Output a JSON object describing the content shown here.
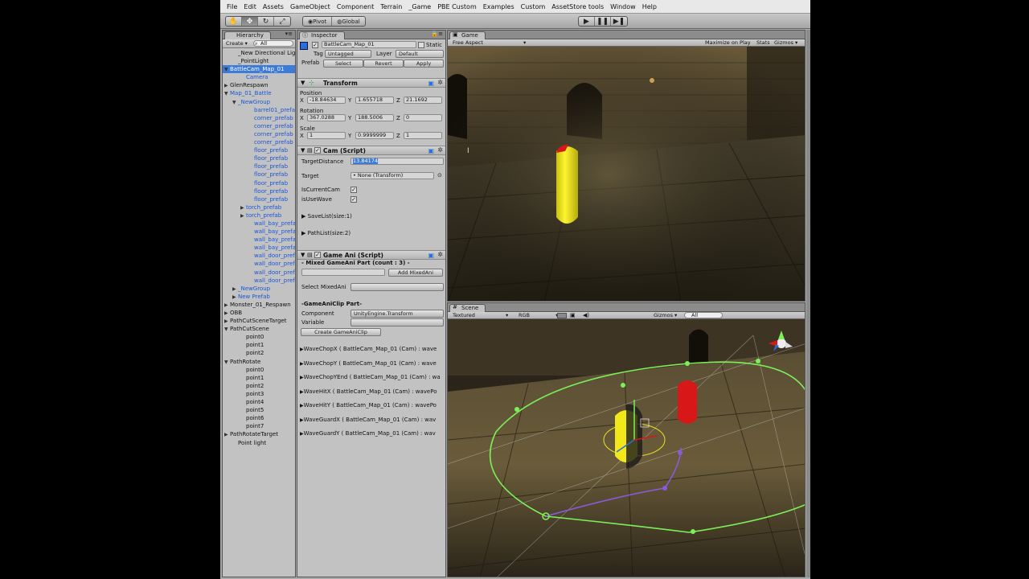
{
  "menu": [
    "File",
    "Edit",
    "Assets",
    "GameObject",
    "Component",
    "Terrain",
    "_Game",
    "PBE Custom",
    "Examples",
    "Custom",
    "AssetStore tools",
    "Window",
    "Help"
  ],
  "toolbar": {
    "pivot": "Pivot",
    "global": "Global"
  },
  "hierarchy": {
    "tab": "Hierarchy",
    "create": "Create ▾",
    "search": "All",
    "rows": [
      {
        "label": "_New Directional Light",
        "indent": 1,
        "arrow": "",
        "style": ""
      },
      {
        "label": "_PointLight",
        "indent": 1,
        "arrow": "",
        "style": ""
      },
      {
        "label": "BattleCam_Map_01",
        "indent": 0,
        "arrow": "▼",
        "style": "sel"
      },
      {
        "label": "Camera",
        "indent": 2,
        "arrow": "",
        "style": "blue"
      },
      {
        "label": "GlenRespawn",
        "indent": 0,
        "arrow": "▶",
        "style": ""
      },
      {
        "label": "Map_01_Battle",
        "indent": 0,
        "arrow": "▼",
        "style": "blue"
      },
      {
        "label": "_NewGroup",
        "indent": 1,
        "arrow": "▼",
        "style": "blue"
      },
      {
        "label": "barrel01_prefab",
        "indent": 3,
        "arrow": "",
        "style": "blue"
      },
      {
        "label": "corner_prefab",
        "indent": 3,
        "arrow": "",
        "style": "blue"
      },
      {
        "label": "corner_prefab",
        "indent": 3,
        "arrow": "",
        "style": "blue"
      },
      {
        "label": "corner_prefab",
        "indent": 3,
        "arrow": "",
        "style": "blue"
      },
      {
        "label": "corner_prefab",
        "indent": 3,
        "arrow": "",
        "style": "blue"
      },
      {
        "label": "floor_prefab",
        "indent": 3,
        "arrow": "",
        "style": "blue"
      },
      {
        "label": "floor_prefab",
        "indent": 3,
        "arrow": "",
        "style": "blue"
      },
      {
        "label": "floor_prefab",
        "indent": 3,
        "arrow": "",
        "style": "blue"
      },
      {
        "label": "floor_prefab",
        "indent": 3,
        "arrow": "",
        "style": "blue"
      },
      {
        "label": "floor_prefab",
        "indent": 3,
        "arrow": "",
        "style": "blue"
      },
      {
        "label": "floor_prefab",
        "indent": 3,
        "arrow": "",
        "style": "blue"
      },
      {
        "label": "floor_prefab",
        "indent": 3,
        "arrow": "",
        "style": "blue"
      },
      {
        "label": "torch_prefab",
        "indent": 2,
        "arrow": "▶",
        "style": "blue"
      },
      {
        "label": "torch_prefab",
        "indent": 2,
        "arrow": "▶",
        "style": "blue"
      },
      {
        "label": "wall_bay_prefab",
        "indent": 3,
        "arrow": "",
        "style": "blue"
      },
      {
        "label": "wall_bay_prefab",
        "indent": 3,
        "arrow": "",
        "style": "blue"
      },
      {
        "label": "wall_bay_prefab",
        "indent": 3,
        "arrow": "",
        "style": "blue"
      },
      {
        "label": "wall_bay_prefab",
        "indent": 3,
        "arrow": "",
        "style": "blue"
      },
      {
        "label": "wall_door_prefab",
        "indent": 3,
        "arrow": "",
        "style": "blue"
      },
      {
        "label": "wall_door_prefab",
        "indent": 3,
        "arrow": "",
        "style": "blue"
      },
      {
        "label": "wall_door_prefab",
        "indent": 3,
        "arrow": "",
        "style": "blue"
      },
      {
        "label": "wall_door_prefab",
        "indent": 3,
        "arrow": "",
        "style": "blue"
      },
      {
        "label": "_NewGroup",
        "indent": 1,
        "arrow": "▶",
        "style": "blue"
      },
      {
        "label": "New Prefab",
        "indent": 1,
        "arrow": "▶",
        "style": "blue"
      },
      {
        "label": "Monster_01_Respawn",
        "indent": 0,
        "arrow": "▶",
        "style": ""
      },
      {
        "label": "OBB",
        "indent": 0,
        "arrow": "▶",
        "style": ""
      },
      {
        "label": "PathCutSceneTarget",
        "indent": 0,
        "arrow": "▶",
        "style": ""
      },
      {
        "label": "PathCutScene",
        "indent": 0,
        "arrow": "▼",
        "style": ""
      },
      {
        "label": "point0",
        "indent": 2,
        "arrow": "",
        "style": ""
      },
      {
        "label": "point1",
        "indent": 2,
        "arrow": "",
        "style": ""
      },
      {
        "label": "point2",
        "indent": 2,
        "arrow": "",
        "style": ""
      },
      {
        "label": "PathRotate",
        "indent": 0,
        "arrow": "▼",
        "style": ""
      },
      {
        "label": "point0",
        "indent": 2,
        "arrow": "",
        "style": ""
      },
      {
        "label": "point1",
        "indent": 2,
        "arrow": "",
        "style": ""
      },
      {
        "label": "point2",
        "indent": 2,
        "arrow": "",
        "style": ""
      },
      {
        "label": "point3",
        "indent": 2,
        "arrow": "",
        "style": ""
      },
      {
        "label": "point4",
        "indent": 2,
        "arrow": "",
        "style": ""
      },
      {
        "label": "point5",
        "indent": 2,
        "arrow": "",
        "style": ""
      },
      {
        "label": "point6",
        "indent": 2,
        "arrow": "",
        "style": ""
      },
      {
        "label": "point7",
        "indent": 2,
        "arrow": "",
        "style": ""
      },
      {
        "label": "PathRotateTarget",
        "indent": 0,
        "arrow": "▶",
        "style": ""
      },
      {
        "label": "Point light",
        "indent": 1,
        "arrow": "",
        "style": ""
      }
    ]
  },
  "inspector": {
    "tab": "Inspector",
    "object_name": "BattleCam_Map_01",
    "static": "Static",
    "tag_label": "Tag",
    "tag_value": "Untagged",
    "layer_label": "Layer",
    "layer_value": "Default",
    "prefab_label": "Prefab",
    "select": "Select",
    "revert": "Revert",
    "apply": "Apply",
    "transform": {
      "title": "Transform",
      "position_label": "Position",
      "rotation_label": "Rotation",
      "scale_label": "Scale",
      "x": "X",
      "y": "Y",
      "z": "Z",
      "position": [
        "-18.84634",
        "1.655718",
        "21.1692"
      ],
      "rotation": [
        "367.0288",
        "188.5006",
        "0"
      ],
      "scale": [
        "1",
        "0.9999999",
        "1"
      ]
    },
    "cam": {
      "title": "Cam (Script)",
      "target_distance_label": "TargetDistance",
      "target_distance": "13.84174",
      "target_label": "Target",
      "target_value": "• None (Transform)",
      "is_current_cam": "IsCurrentCam",
      "is_use_wave": "isUseWave",
      "save_list": "SaveList(size:1)",
      "path_list": "PathList(size:2)"
    },
    "game_ani": {
      "title": "Game Ani (Script)",
      "mixed_part": "- Mixed GameAni Part (count : 3) -",
      "add_mixed": "Add MixedAni",
      "select_mixed": "Select MixedAni",
      "clip_part": "-GameAniClip Part-",
      "component_label": "Component",
      "component_value": "UnityEngine.Transform",
      "variable_label": "Variable",
      "create_clip": "Create GameAniClip",
      "clips": [
        "WaveChopX ( BattleCam_Map_01 (Cam) : wave",
        "WaveChopY ( BattleCam_Map_01 (Cam) : wave",
        "WaveChopYEnd ( BattleCam_Map_01 (Cam) : wa",
        "WaveHitX ( BattleCam_Map_01 (Cam) : wavePo",
        "WaveHitY ( BattleCam_Map_01 (Cam) : wavePo",
        "WaveGuardX ( BattleCam_Map_01 (Cam) : wav",
        "WaveGuardY ( BattleCam_Map_01 (Cam) : wav"
      ]
    }
  },
  "game": {
    "tab": "Game",
    "aspect": "Free Aspect",
    "maximize": "Maximize on Play",
    "stats": "Stats",
    "gizmos": "Gizmos ▾"
  },
  "scene": {
    "tab": "Scene",
    "render_mode": "Textured",
    "color_mode": "RGB",
    "gizmos": "Gizmos ▾",
    "search": "All"
  },
  "colors": {
    "selection": "#3d7bd8",
    "prefab_text": "#1a56d6",
    "path_green": "#7cf05a",
    "path_purple": "#8a5ae0",
    "capsule_yellow": "#f2e81a",
    "capsule_red": "#d81818"
  }
}
